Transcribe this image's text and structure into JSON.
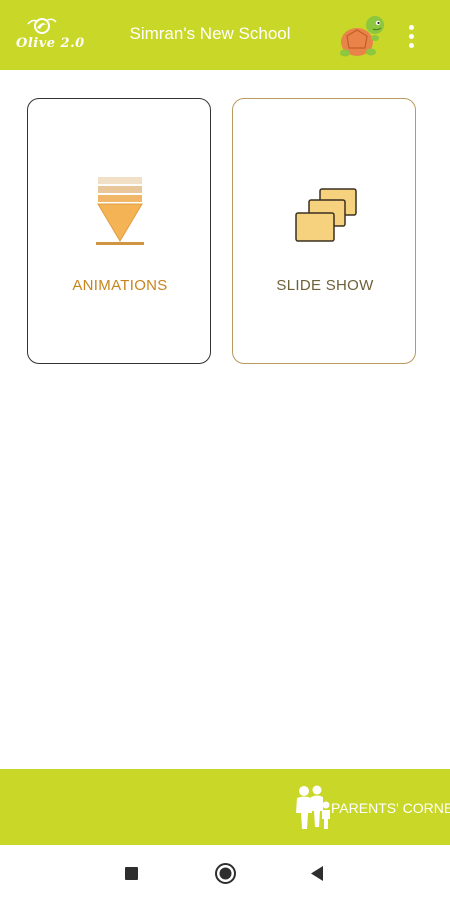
{
  "app_bar": {
    "logo_text": "Olive 2.0",
    "title": "Simran's New School",
    "mascot_icon": "turtle-mascot-icon",
    "menu_icon": "more-vert-icon",
    "color": "#c9d728"
  },
  "cards": [
    {
      "label": "ANIMATIONS",
      "icon": "layered-funnel-icon",
      "label_color": "#c8841d",
      "border_color": "#333333"
    },
    {
      "label": "SLIDE SHOW",
      "icon": "stacked-slides-icon",
      "label_color": "#6e6138",
      "border_color": "#b99a5f"
    }
  ],
  "bottom_bar": {
    "parents_corner_label": "PARENTS' CORNER",
    "family_icon": "family-icon",
    "color": "#c9d728"
  },
  "system_nav": {
    "buttons": [
      "recent-apps-icon",
      "home-icon",
      "back-icon"
    ]
  }
}
